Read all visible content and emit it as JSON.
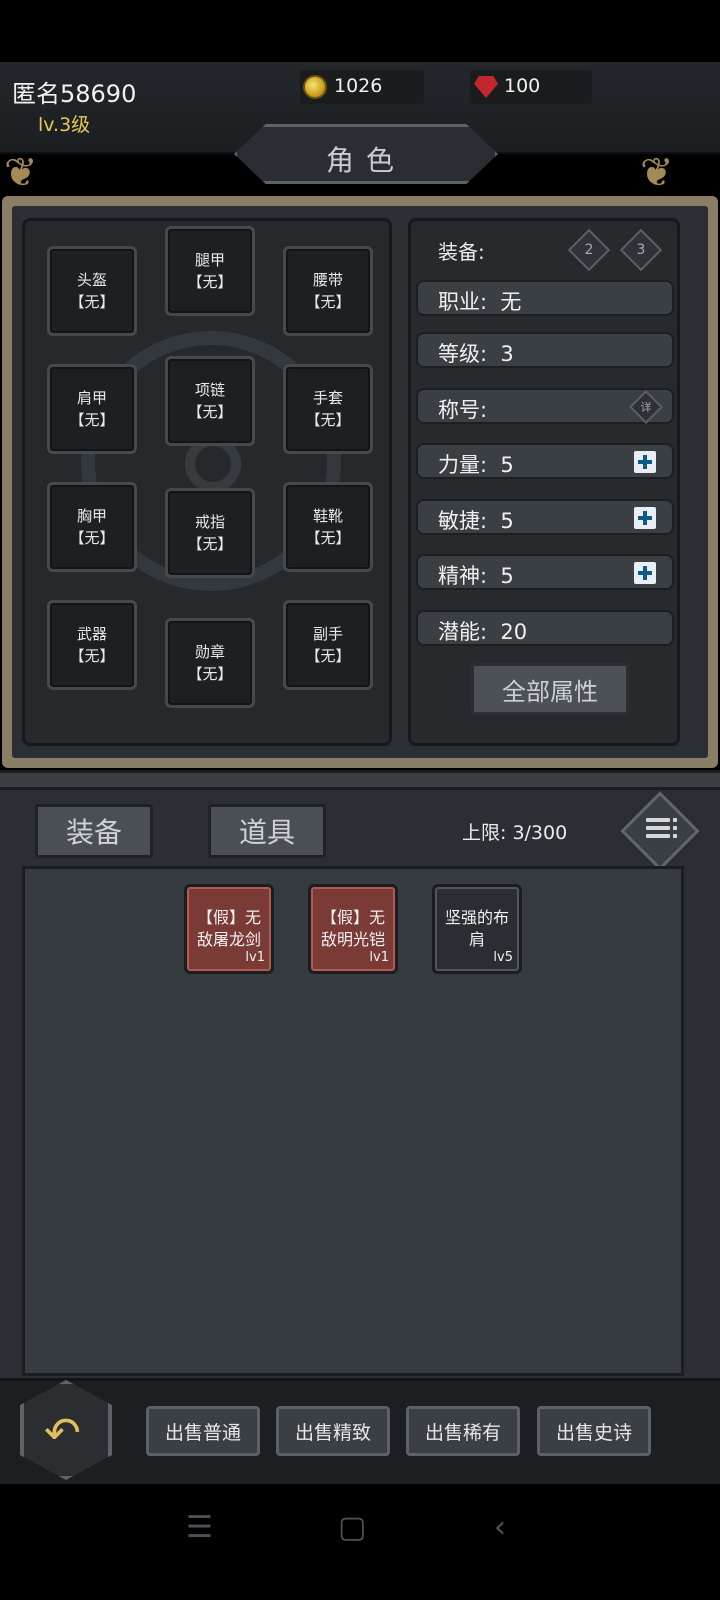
{
  "player": {
    "name": "匿名58690",
    "level": "lv.3级"
  },
  "currencies": {
    "gold": "1026",
    "gems": "100"
  },
  "title": "角色",
  "equipment_slots": [
    {
      "label": "头盔\n【无】"
    },
    {
      "label": "腿甲\n【无】"
    },
    {
      "label": "腰带\n【无】"
    },
    {
      "label": "肩甲\n【无】"
    },
    {
      "label": "项链\n【无】"
    },
    {
      "label": "手套\n【无】"
    },
    {
      "label": "胸甲\n【无】"
    },
    {
      "label": "戒指\n【无】"
    },
    {
      "label": "鞋靴\n【无】"
    },
    {
      "label": "武器\n【无】"
    },
    {
      "label": "勋章\n【无】"
    },
    {
      "label": "副手\n【无】"
    }
  ],
  "stats": {
    "equip_label": "装备:",
    "set_buttons": [
      "2",
      "3"
    ],
    "rows": [
      {
        "text": "职业:  无"
      },
      {
        "text": "等级:  3"
      },
      {
        "text": "称号:",
        "detail": "详"
      },
      {
        "text": "力量:  5"
      },
      {
        "text": "敏捷:  5"
      },
      {
        "text": "精神:  5"
      },
      {
        "text": "潜能:  20"
      }
    ],
    "all_attributes_label": "全部属性"
  },
  "inventory": {
    "tabs": [
      "装备",
      "道具"
    ],
    "capacity": "上限:  3/300",
    "items": [
      {
        "name": "【假】无敌屠龙剑",
        "level": "lv1",
        "rarity": "red"
      },
      {
        "name": "【假】无敌明光铠",
        "level": "lv1",
        "rarity": "red"
      },
      {
        "name": "坚强的布肩",
        "level": "lv5",
        "rarity": "normal"
      }
    ]
  },
  "sell_buttons": [
    "出售普通",
    "出售精致",
    "出售稀有",
    "出售史诗"
  ],
  "icons": {
    "gold": "coin-icon",
    "gems": "gem-icon",
    "back": "back-arrow-icon",
    "menu": "list-menu-icon",
    "nav": [
      "menu-icon",
      "home-icon",
      "back-icon"
    ]
  },
  "colors": {
    "accent_gold": "#e8c85a",
    "rare_red": "#7a3a36",
    "panel": "#2b2f33"
  }
}
